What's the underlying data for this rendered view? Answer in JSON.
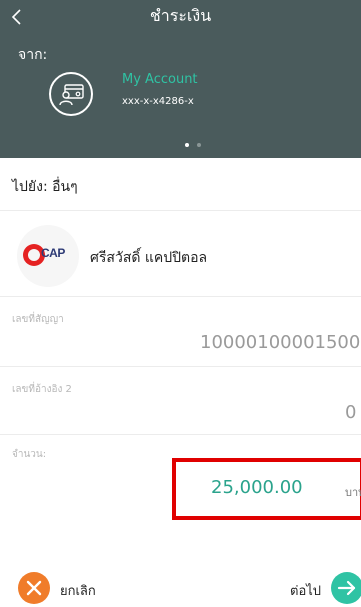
{
  "header": {
    "title": "ชำระเงิน",
    "from_label": "จาก:",
    "account_name": "My Account",
    "account_number": "xxx-x-x4286-x"
  },
  "to": {
    "label": "ไปยัง: อื่นๆ",
    "biller_logo_text": "CAP",
    "biller_name": "ศรีสวัสดิ์ แคปปิตอล"
  },
  "fields": {
    "contract_label": "เลขที่สัญญา",
    "contract_value": "10000100001500",
    "ref2_label": "เลขที่อ้างอิง 2",
    "ref2_value": "0",
    "amount_label": "จำนวน:",
    "amount_value": "25,000.00",
    "amount_unit": "บาท"
  },
  "footer": {
    "cancel_label": "ยกเลิก",
    "next_label": "ต่อไป"
  },
  "colors": {
    "header_bg": "#4a5b5c",
    "accent_green": "#2fc3a4",
    "amount_green": "#2aa38c",
    "cancel_orange": "#f07c2a",
    "highlight_red": "#e00000"
  }
}
